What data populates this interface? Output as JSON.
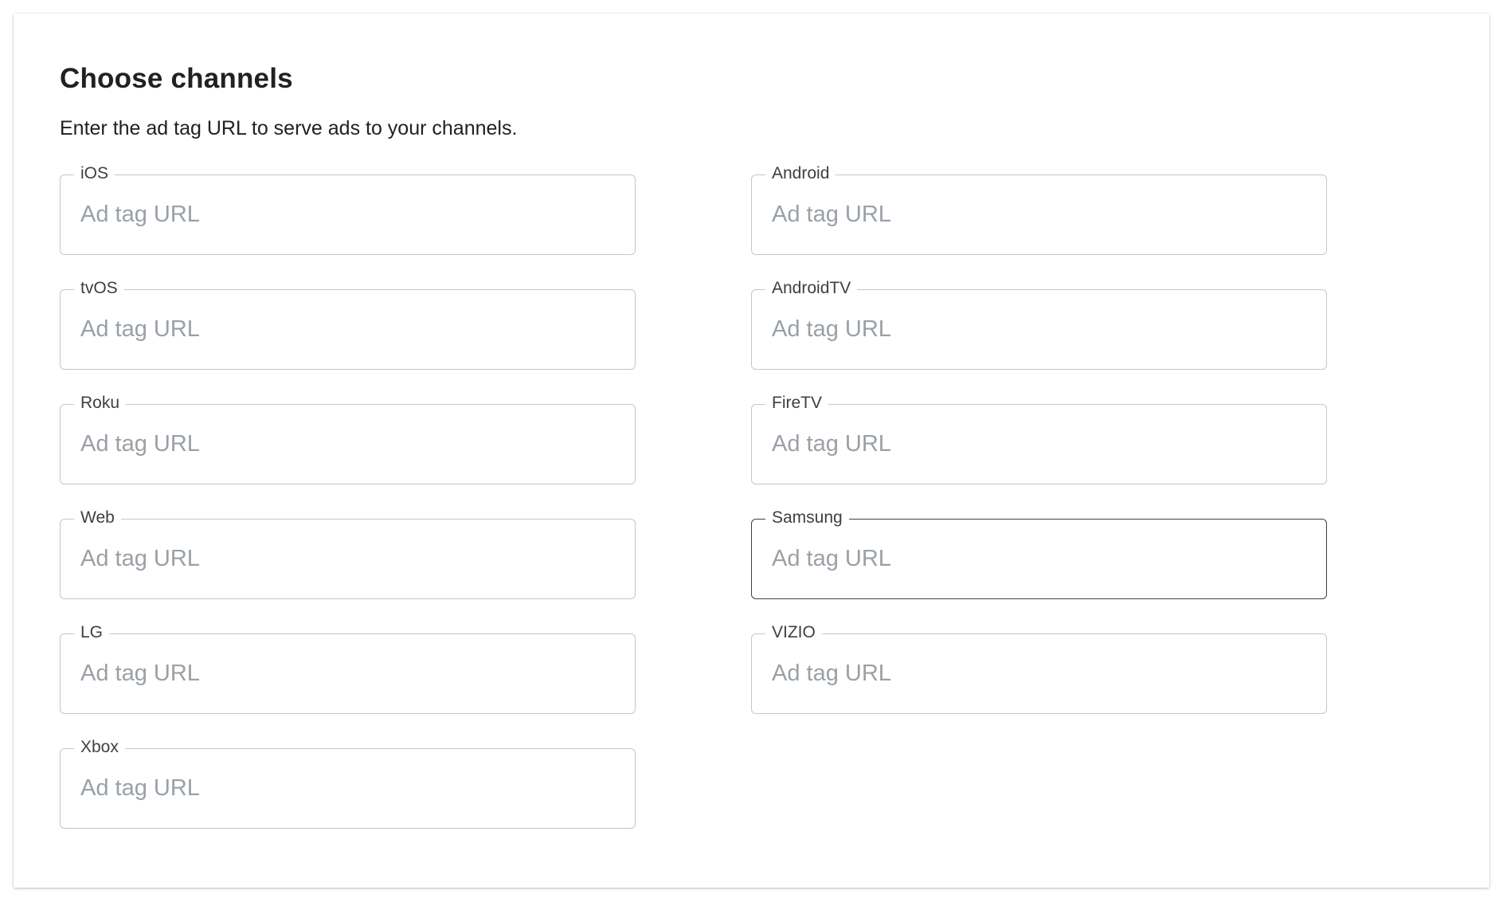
{
  "page": {
    "title": "Choose channels",
    "subtitle": "Enter the ad tag URL to serve ads to your channels."
  },
  "fields": {
    "ios": {
      "label": "iOS",
      "placeholder": "Ad tag URL",
      "value": ""
    },
    "android": {
      "label": "Android",
      "placeholder": "Ad tag URL",
      "value": ""
    },
    "tvos": {
      "label": "tvOS",
      "placeholder": "Ad tag URL",
      "value": ""
    },
    "androidtv": {
      "label": "AndroidTV",
      "placeholder": "Ad tag URL",
      "value": ""
    },
    "roku": {
      "label": "Roku",
      "placeholder": "Ad tag URL",
      "value": ""
    },
    "firetv": {
      "label": "FireTV",
      "placeholder": "Ad tag URL",
      "value": ""
    },
    "web": {
      "label": "Web",
      "placeholder": "Ad tag URL",
      "value": ""
    },
    "samsung": {
      "label": "Samsung",
      "placeholder": "Ad tag URL",
      "value": "",
      "focused": true
    },
    "lg": {
      "label": "LG",
      "placeholder": "Ad tag URL",
      "value": ""
    },
    "vizio": {
      "label": "VIZIO",
      "placeholder": "Ad tag URL",
      "value": ""
    },
    "xbox": {
      "label": "Xbox",
      "placeholder": "Ad tag URL",
      "value": ""
    }
  },
  "colors": {
    "border": "#c6c6c6",
    "focused_border": "#3c4043",
    "placeholder": "#9aa0a6",
    "text": "#202124"
  }
}
